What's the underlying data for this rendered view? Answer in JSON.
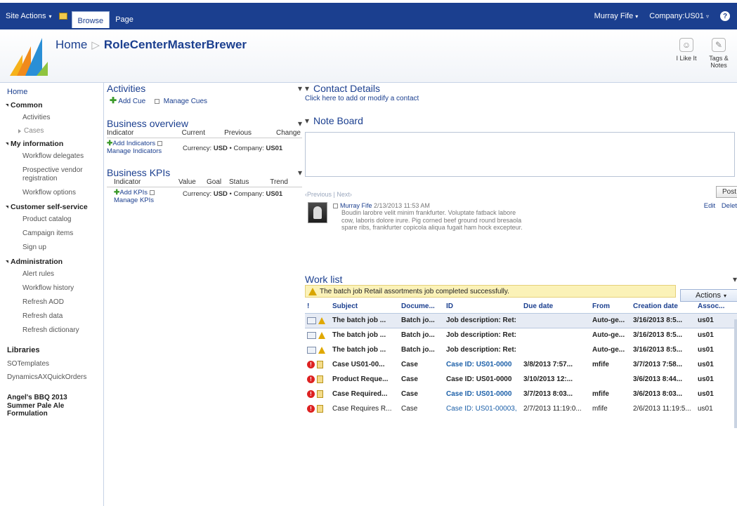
{
  "ribbon": {
    "site_actions": "Site Actions",
    "tab_browse": "Browse",
    "tab_page": "Page",
    "user": "Murray Fife",
    "company": "Company:US01",
    "help": "?"
  },
  "title": {
    "home": "Home",
    "current": "RoleCenterMasterBrewer",
    "i_like_it": "I Like It",
    "tags_notes_1": "Tags &",
    "tags_notes_2": "Notes"
  },
  "leftnav": {
    "home": "Home",
    "common": "Common",
    "activities": "Activities",
    "cases": "Cases",
    "my_information": "My information",
    "workflow_delegates": "Workflow delegates",
    "prospective_vendor": "Prospective vendor registration",
    "workflow_options": "Workflow options",
    "customer_self_service": "Customer self-service",
    "product_catalog": "Product catalog",
    "campaign_items": "Campaign items",
    "sign_up": "Sign up",
    "administration": "Administration",
    "alert_rules": "Alert rules",
    "workflow_history": "Workflow history",
    "refresh_aod": "Refresh AOD",
    "refresh_data": "Refresh data",
    "refresh_dictionary": "Refresh dictionary",
    "libraries": "Libraries",
    "sotemplates": "SOTemplates",
    "dynamics_orders": "DynamicsAXQuickOrders",
    "angels_1": "Angel's BBQ 2013",
    "angels_2": "Summer Pale Ale",
    "angels_3": "Formulation"
  },
  "activities": {
    "title": "Activities",
    "add_cue": "Add Cue",
    "manage_cues": "Manage Cues"
  },
  "business_overview": {
    "title": "Business overview",
    "col_indicator": "Indicator",
    "col_current": "Current",
    "col_previous": "Previous",
    "col_change": "Change",
    "add_indicators": "Add Indicators",
    "manage_indicators": "Manage Indicators",
    "currency_label": "Currency:",
    "currency_value": "USD",
    "company_label": "Company:",
    "company_value": "US01"
  },
  "business_kpis": {
    "title": "Business KPIs",
    "col_indicator": "Indicator",
    "col_value": "Value",
    "col_goal": "Goal",
    "col_status": "Status",
    "col_trend": "Trend",
    "add_kpis": "Add KPIs",
    "manage_kpis": "Manage KPIs",
    "currency_label": "Currency:",
    "currency_value": "USD",
    "company_label": "Company:",
    "company_value": "US01"
  },
  "contact_details": {
    "title": "Contact Details",
    "link": "Click here to add or modify a contact"
  },
  "note_board": {
    "title": "Note Board",
    "post": "Post",
    "previous": "‹Previous",
    "next": "Next›",
    "author": "Murray Fife",
    "timestamp": "2/13/2013 11:53 AM",
    "body_1": "Boudin larobre velit minim frankfurter.  Voluptate fatback labore",
    "body_2": "cow, laboris dolore irure. Pig corned beef ground round bresaola",
    "body_3": "spare ribs, frankfurter copicola aliqua fugait ham hock excepteur.",
    "edit": "Edit",
    "delete": "Delet"
  },
  "worklist": {
    "title": "Work list",
    "banner": "The batch job Retail assortments job completed successfully.",
    "actions": "Actions",
    "headers": [
      "!",
      "Subject",
      "Docume...",
      "ID",
      "Due date",
      "From",
      "Creation date",
      "Assoc..."
    ],
    "rows": [
      {
        "kind": "alert",
        "subject": "The batch job ...",
        "doc": "Batch jo...",
        "id": "Job description: Ret:",
        "due": "",
        "from": "Auto-ge...",
        "created": "3/16/2013 8:5...",
        "assoc": "us01",
        "bold": true,
        "selected": true,
        "id_link": false
      },
      {
        "kind": "alert",
        "subject": "The batch job ...",
        "doc": "Batch jo...",
        "id": "Job description: Ret:",
        "due": "",
        "from": "Auto-ge...",
        "created": "3/16/2013 8:5...",
        "assoc": "us01",
        "bold": true,
        "selected": false,
        "id_link": false
      },
      {
        "kind": "alert",
        "subject": "The batch job ...",
        "doc": "Batch jo...",
        "id": "Job description: Ret:",
        "due": "",
        "from": "Auto-ge...",
        "created": "3/16/2013 8:5...",
        "assoc": "us01",
        "bold": true,
        "selected": false,
        "id_link": false
      },
      {
        "kind": "case",
        "subject": "Case US01-00...",
        "doc": "Case",
        "id": "Case ID: US01-0000",
        "due": "3/8/2013 7:57...",
        "from": "mfife",
        "created": "3/7/2013 7:58...",
        "assoc": "us01",
        "bold": true,
        "selected": false,
        "id_link": true
      },
      {
        "kind": "case",
        "subject": "Product Reque...",
        "doc": "Case",
        "id": "Case ID: US01-0000",
        "due": "3/10/2013 12:...",
        "from": "",
        "created": "3/6/2013 8:44...",
        "assoc": "us01",
        "bold": true,
        "selected": false,
        "id_link": false
      },
      {
        "kind": "case",
        "subject": "Case Required...",
        "doc": "Case",
        "id": "Case ID: US01-0000",
        "due": "3/7/2013 8:03...",
        "from": "mfife",
        "created": "3/6/2013 8:03...",
        "assoc": "us01",
        "bold": true,
        "selected": false,
        "id_link": true
      },
      {
        "kind": "case",
        "subject": "Case Requires R...",
        "doc": "Case",
        "id": "Case ID: US01-00003,",
        "due": "2/7/2013 11:19:0...",
        "from": "mfife",
        "created": "2/6/2013 11:19:5...",
        "assoc": "us01",
        "bold": false,
        "selected": false,
        "id_link": true
      }
    ]
  },
  "colors": {
    "ribbon": "#1b3f8f",
    "link": "#1b3f8f",
    "banner": "#fbf2b8"
  }
}
